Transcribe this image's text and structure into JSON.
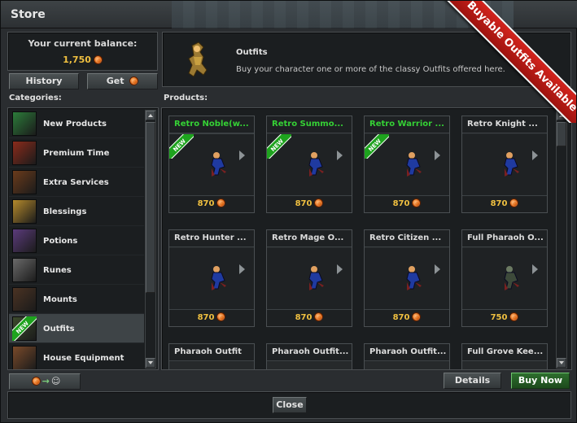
{
  "window": {
    "title": "Store"
  },
  "balance": {
    "label": "Your current balance:",
    "amount": "1,750",
    "currency_icon": "tibia-coin-icon",
    "currency_color": "#d35400"
  },
  "buttons": {
    "history": "History",
    "get": "Get",
    "details": "Details",
    "buy_now": "Buy Now",
    "close": "Close",
    "transfer": "→"
  },
  "info": {
    "title": "Outfits",
    "description": "Buy your character one or more of the classy Outfits offered here."
  },
  "ribbon": {
    "text": "Buyable Outfits Available",
    "color": "#c0201a"
  },
  "labels": {
    "categories": "Categories:",
    "products": "Products:"
  },
  "categories": [
    {
      "label": "New Products",
      "icon": "new-products-icon",
      "color": "#2c7c3a",
      "selected": false
    },
    {
      "label": "Premium Time",
      "icon": "premium-time-icon",
      "color": "#8b2b1b",
      "selected": false
    },
    {
      "label": "Extra Services",
      "icon": "extra-services-icon",
      "color": "#6b3b1b",
      "selected": false
    },
    {
      "label": "Blessings",
      "icon": "blessings-icon",
      "color": "#b48a2c",
      "selected": false
    },
    {
      "label": "Potions",
      "icon": "potions-icon",
      "color": "#5b3b7c",
      "selected": false
    },
    {
      "label": "Runes",
      "icon": "runes-icon",
      "color": "#6a6a6a",
      "selected": false
    },
    {
      "label": "Mounts",
      "icon": "mounts-icon",
      "color": "#4b3323",
      "selected": false
    },
    {
      "label": "Outfits",
      "icon": "outfits-icon",
      "color": "#3c4a2c",
      "selected": true
    },
    {
      "label": "House Equipment",
      "icon": "house-equipment-icon",
      "color": "#7a4a2a",
      "selected": false
    }
  ],
  "products": [
    {
      "name": "Retro Noble(w...",
      "price": "870",
      "is_new": true,
      "selected": true,
      "character": "retro-noble"
    },
    {
      "name": "Retro Summo...",
      "price": "870",
      "is_new": true,
      "selected": false,
      "character": "retro-summoner"
    },
    {
      "name": "Retro Warrior ...",
      "price": "870",
      "is_new": true,
      "selected": false,
      "character": "retro-warrior"
    },
    {
      "name": "Retro Knight ...",
      "price": "870",
      "is_new": false,
      "selected": false,
      "character": "retro-knight"
    },
    {
      "name": "Retro Hunter ...",
      "price": "870",
      "is_new": false,
      "selected": false,
      "character": "retro-hunter"
    },
    {
      "name": "Retro Mage O...",
      "price": "870",
      "is_new": false,
      "selected": false,
      "character": "retro-mage"
    },
    {
      "name": "Retro Citizen ...",
      "price": "870",
      "is_new": false,
      "selected": false,
      "character": "retro-citizen"
    },
    {
      "name": "Full Pharaoh O...",
      "price": "750",
      "is_new": false,
      "selected": false,
      "character": "pharaoh"
    },
    {
      "name": "Pharaoh Outfit",
      "price": "",
      "is_new": false,
      "selected": false,
      "character": ""
    },
    {
      "name": "Pharaoh Outfit...",
      "price": "",
      "is_new": false,
      "selected": false,
      "character": ""
    },
    {
      "name": "Pharaoh Outfit...",
      "price": "",
      "is_new": false,
      "selected": false,
      "character": ""
    },
    {
      "name": "Full Grove Kee...",
      "price": "",
      "is_new": false,
      "selected": false,
      "character": ""
    }
  ],
  "new_badge_text": "NEW"
}
